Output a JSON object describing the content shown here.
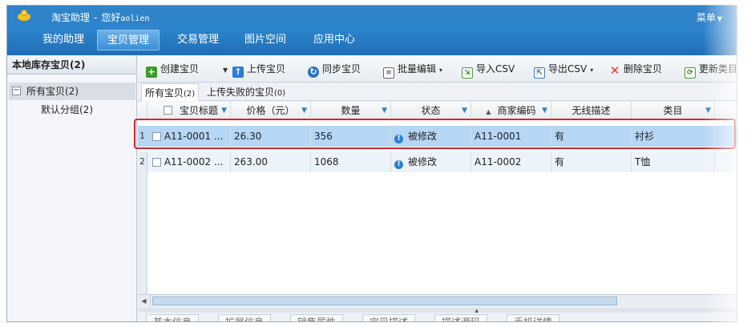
{
  "app": {
    "title": "淘宝助理",
    "separator": "-",
    "greeting": "您好",
    "user": "aolien",
    "menu_label": "菜单"
  },
  "nav": {
    "tabs": [
      {
        "label": "我的助理"
      },
      {
        "label": "宝贝管理"
      },
      {
        "label": "交易管理"
      },
      {
        "label": "图片空间"
      },
      {
        "label": "应用中心"
      }
    ]
  },
  "sidebar": {
    "header": "本地库存宝贝(2)",
    "root_label": "所有宝贝(2)",
    "child_label": "默认分组(2)"
  },
  "toolbar": {
    "create": "创建宝贝",
    "upload": "上传宝贝",
    "sync": "同步宝贝",
    "batch_edit": "批量编辑",
    "import_csv": "导入CSV",
    "export_csv": "导出CSV",
    "delete": "删除宝贝",
    "update_category": "更新类目"
  },
  "subtabs": {
    "all_label": "所有宝贝",
    "all_count": "(2)",
    "failed_label": "上传失败的宝贝",
    "failed_count": "(0)"
  },
  "table": {
    "columns": [
      "宝贝标题",
      "价格（元）",
      "数量",
      "状态",
      "商家编码",
      "无线描述",
      "类目"
    ],
    "rows": [
      {
        "num": "1",
        "title": "A11-0001 ...",
        "price": "26.30",
        "qty": "356",
        "status": "被修改",
        "code": "A11-0001",
        "mobile": "有",
        "category": "衬衫"
      },
      {
        "num": "2",
        "title": "A11-0002 ...",
        "price": "263.00",
        "qty": "1068",
        "status": "被修改",
        "code": "A11-0002",
        "mobile": "有",
        "category": "T恤"
      }
    ]
  },
  "bottom_tabs": [
    "基本信息",
    "扩展信息",
    "销售属性",
    "宝贝描述",
    "描述源码",
    "手机详情"
  ],
  "colors": {
    "accent": "#2f83c9",
    "selected_row": "#b6d6f5",
    "highlight": "#d9232a"
  }
}
